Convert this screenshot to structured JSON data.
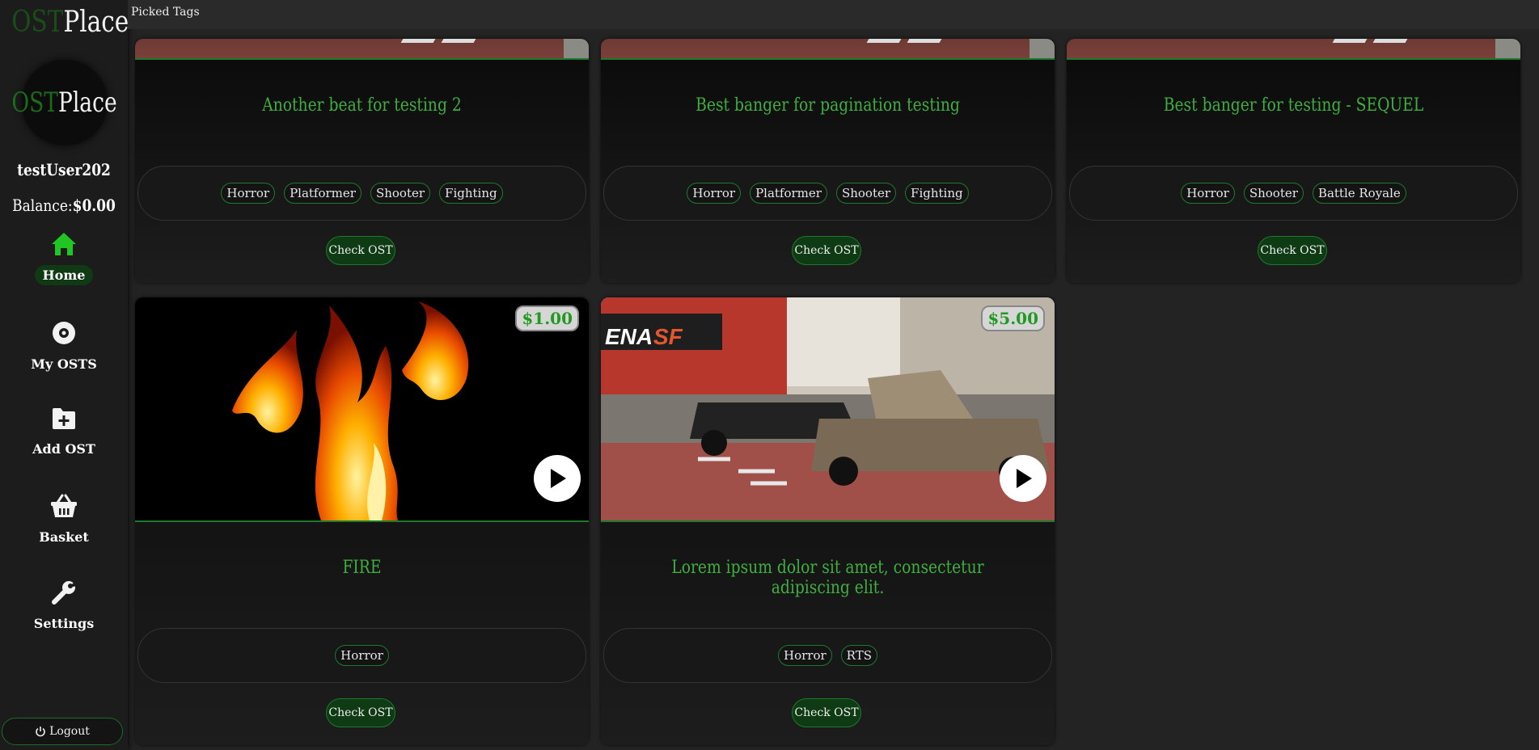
{
  "app": {
    "logo_ost": "OST",
    "logo_place": "Place"
  },
  "user": {
    "name": "testUser202",
    "balance_label": "Balance:",
    "balance_value": "$0.00"
  },
  "nav": [
    {
      "label": "Home",
      "icon": "home-icon",
      "active": true
    },
    {
      "label": "My OSTS",
      "icon": "disc-icon"
    },
    {
      "label": "Add OST",
      "icon": "folder-plus-icon"
    },
    {
      "label": "Basket",
      "icon": "basket-icon"
    },
    {
      "label": "Settings",
      "icon": "wrench-icon"
    }
  ],
  "logout_label": "Logout",
  "topbar": {
    "picked_tags": "Picked Tags"
  },
  "colors": {
    "accent": "#1d7a2c",
    "title_green": "#3fae3f",
    "background": "#232323"
  },
  "cards": [
    {
      "title": "Another beat for testing 2",
      "tags": [
        "Horror",
        "Platformer",
        "Shooter",
        "Fighting"
      ],
      "button": "Check OST"
    },
    {
      "title": "Best banger for pagination testing",
      "tags": [
        "Horror",
        "Platformer",
        "Shooter",
        "Fighting"
      ],
      "button": "Check OST"
    },
    {
      "title": "Best banger for testing - SEQUEL",
      "tags": [
        "Horror",
        "Shooter",
        "Battle Royale"
      ],
      "button": "Check OST"
    },
    {
      "title": "FIRE",
      "price": "$1.00",
      "tags": [
        "Horror"
      ],
      "button": "Check OST"
    },
    {
      "title": "Lorem ipsum dolor sit amet, consectetur adipiscing elit.",
      "price": "$5.00",
      "tags": [
        "Horror",
        "RTS"
      ],
      "button": "Check OST"
    }
  ]
}
